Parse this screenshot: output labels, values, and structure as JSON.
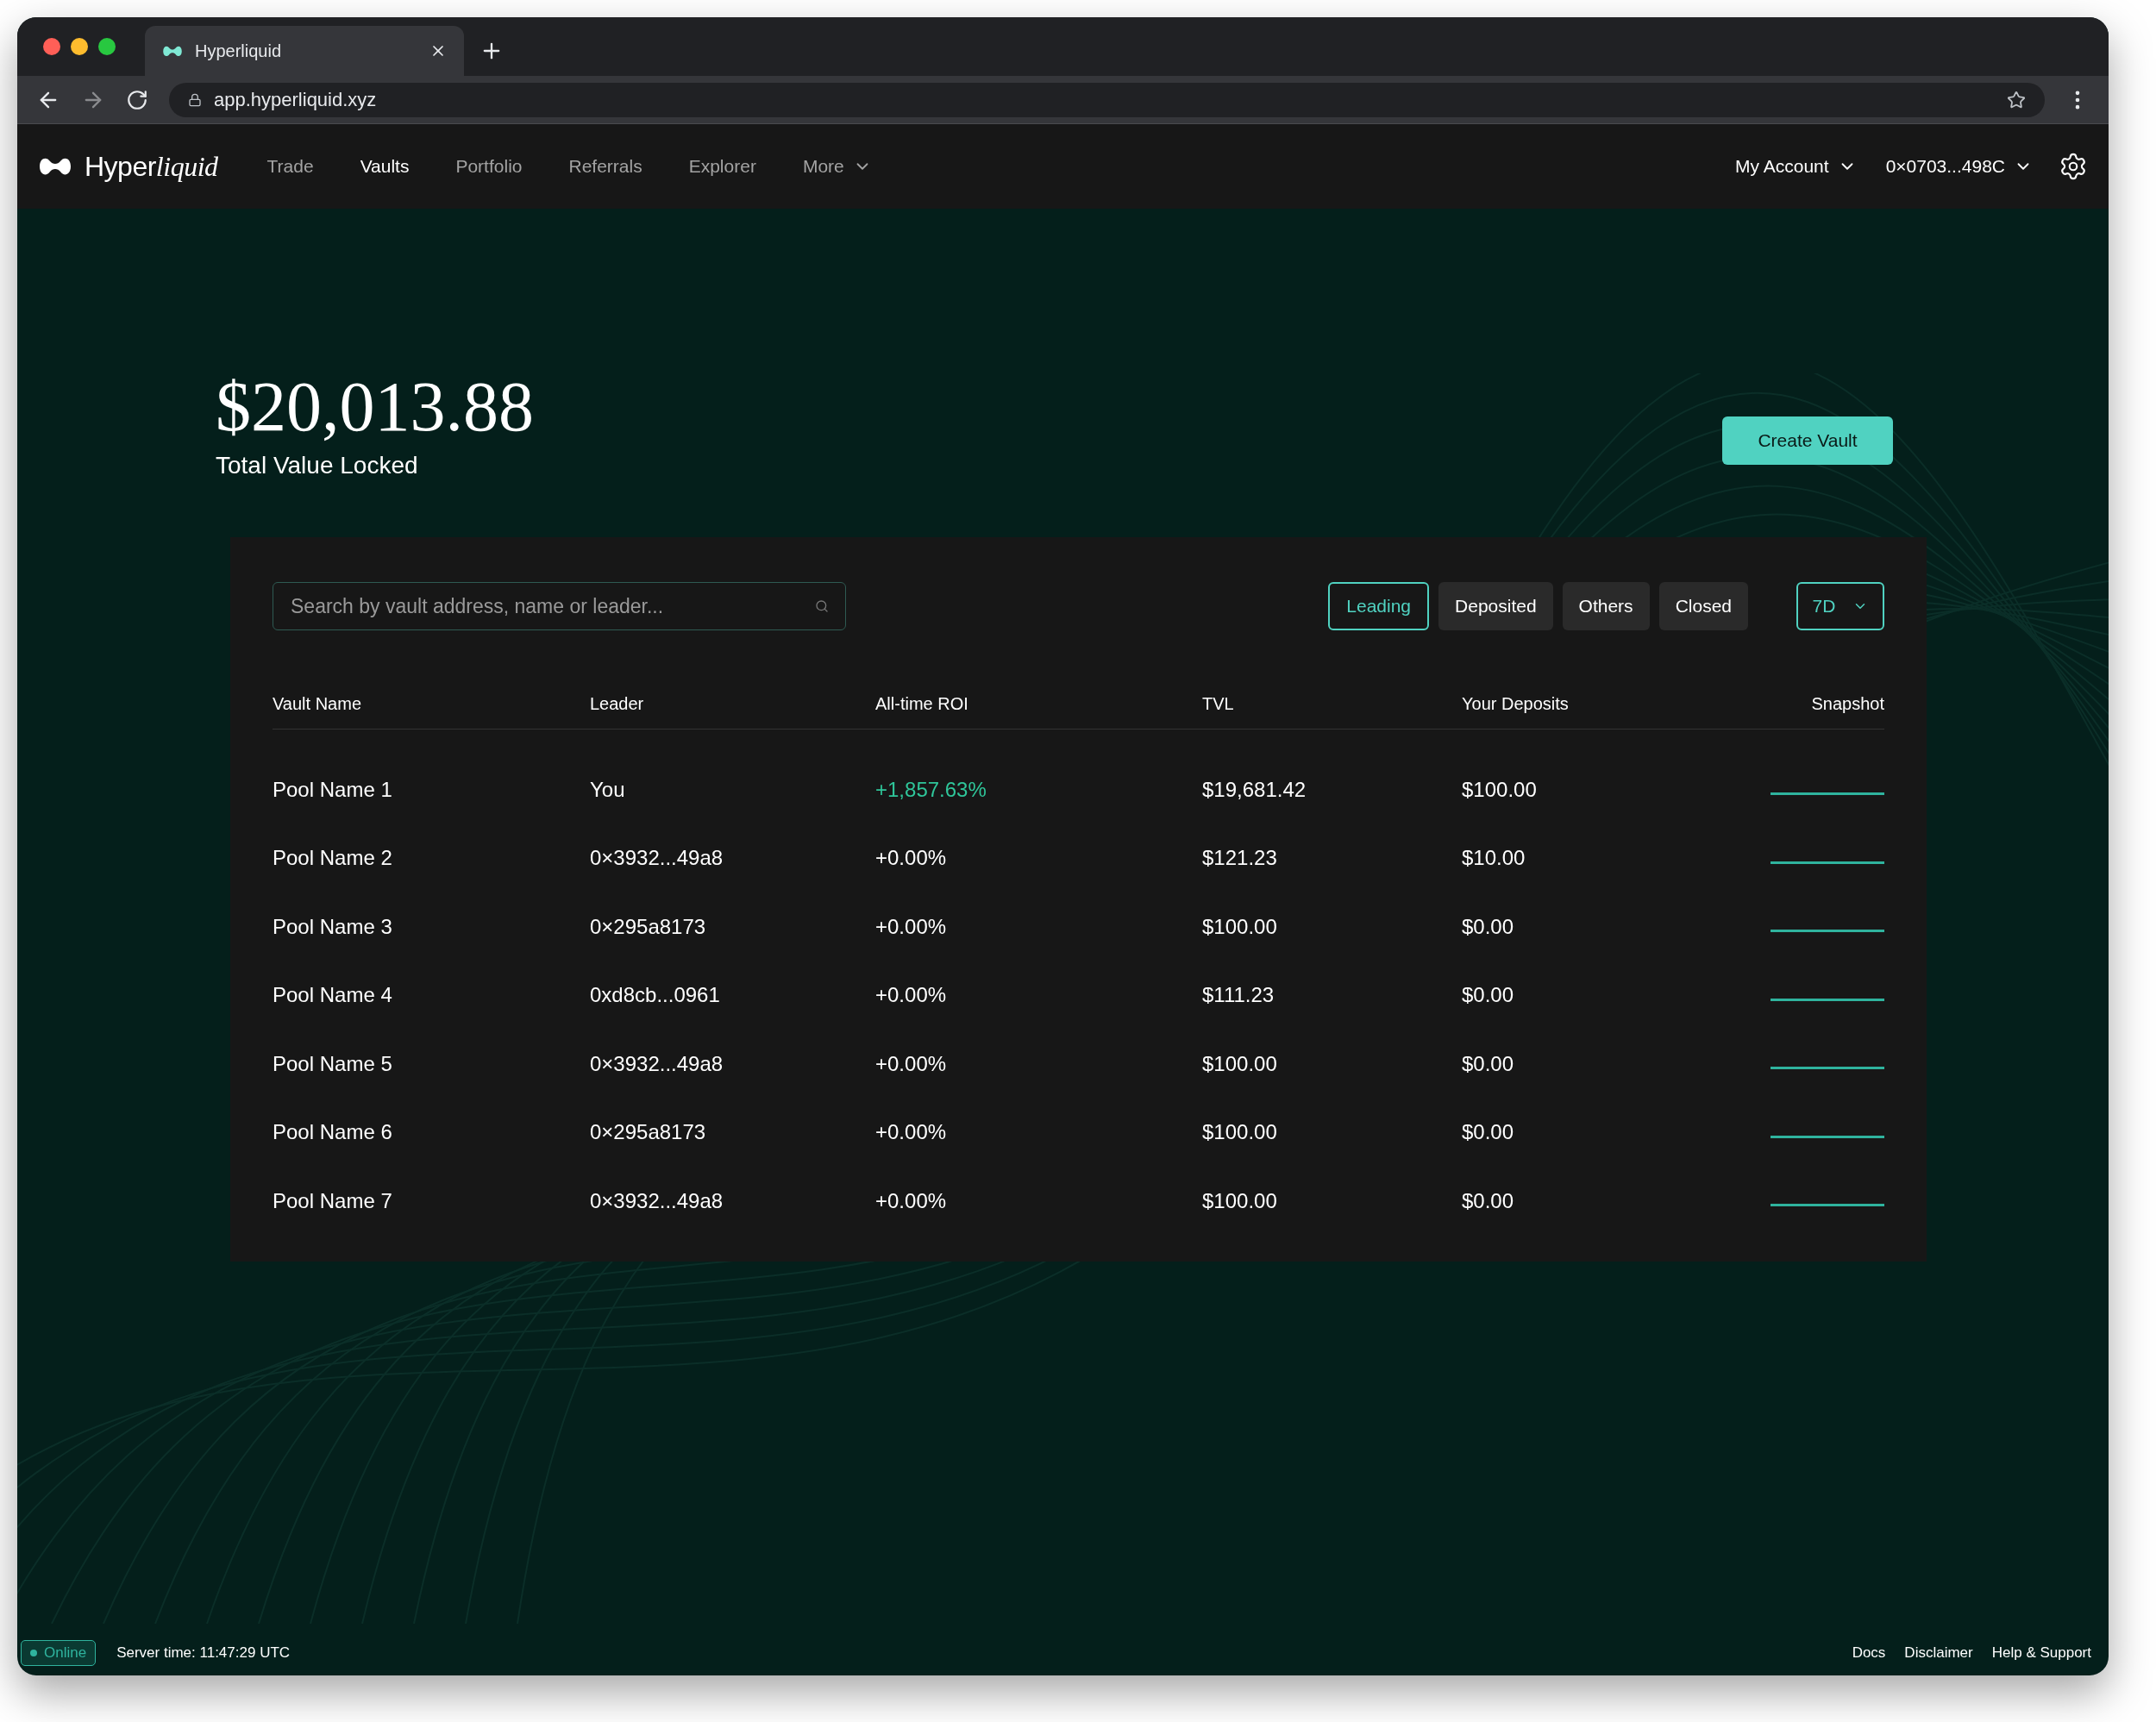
{
  "browser": {
    "tab_title": "Hyperliquid",
    "url": "app.hyperliquid.xyz"
  },
  "nav": {
    "brand_plain": "Hyper",
    "brand_italic": "liquid",
    "items": [
      {
        "label": "Trade",
        "selected": false
      },
      {
        "label": "Vaults",
        "selected": true
      },
      {
        "label": "Portfolio",
        "selected": false
      },
      {
        "label": "Referrals",
        "selected": false
      },
      {
        "label": "Explorer",
        "selected": false
      },
      {
        "label": "More",
        "selected": false,
        "dropdown": true
      }
    ],
    "account": "My Account",
    "wallet": "0×0703...498C"
  },
  "hero": {
    "value": "$20,013.88",
    "label": "Total Value Locked",
    "button": "Create Vault"
  },
  "search": {
    "placeholder": "Search by vault address, name or leader..."
  },
  "filters": [
    {
      "label": "Leading",
      "selected": true
    },
    {
      "label": "Deposited",
      "selected": false
    },
    {
      "label": "Others",
      "selected": false
    },
    {
      "label": "Closed",
      "selected": false
    }
  ],
  "period": "7D",
  "table": {
    "columns": [
      "Vault Name",
      "Leader",
      "All-time ROI",
      "TVL",
      "Your Deposits",
      "Snapshot"
    ],
    "rows": [
      {
        "name": "Pool Name 1",
        "leader": "You",
        "roi": "+1,857.63%",
        "roi_positive": true,
        "tvl": "$19,681.42",
        "deposits": "$100.00"
      },
      {
        "name": "Pool Name 2",
        "leader": "0×3932...49a8",
        "roi": "+0.00%",
        "roi_positive": false,
        "tvl": "$121.23",
        "deposits": "$10.00"
      },
      {
        "name": "Pool Name 3",
        "leader": "0×295a8173",
        "roi": "+0.00%",
        "roi_positive": false,
        "tvl": "$100.00",
        "deposits": "$0.00"
      },
      {
        "name": "Pool Name 4",
        "leader": "0xd8cb...0961",
        "roi": "+0.00%",
        "roi_positive": false,
        "tvl": "$111.23",
        "deposits": "$0.00"
      },
      {
        "name": "Pool Name 5",
        "leader": "0×3932...49a8",
        "roi": "+0.00%",
        "roi_positive": false,
        "tvl": "$100.00",
        "deposits": "$0.00"
      },
      {
        "name": "Pool Name 6",
        "leader": "0×295a8173",
        "roi": "+0.00%",
        "roi_positive": false,
        "tvl": "$100.00",
        "deposits": "$0.00"
      },
      {
        "name": "Pool Name 7",
        "leader": "0×3932...49a8",
        "roi": "+0.00%",
        "roi_positive": false,
        "tvl": "$100.00",
        "deposits": "$0.00"
      }
    ]
  },
  "status_bar": {
    "status": "Online",
    "online": true,
    "server_time": "Server time: 11:47:29 UTC",
    "links": [
      "Docs",
      "Disclaimer",
      "Help & Support"
    ]
  }
}
